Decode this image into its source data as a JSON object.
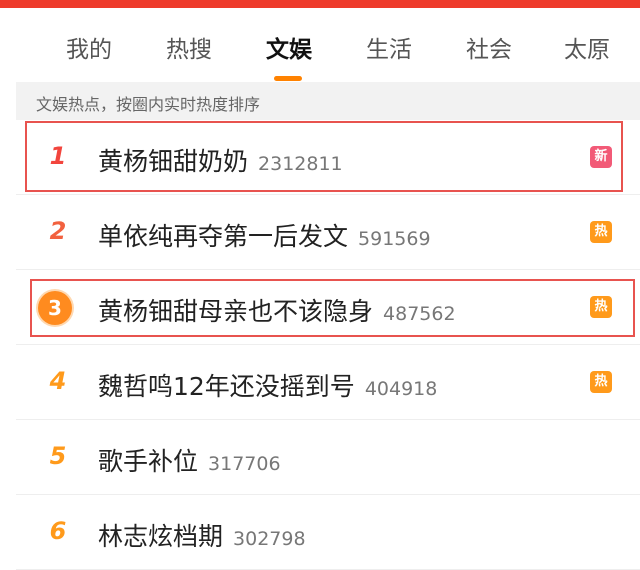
{
  "tabs": [
    {
      "label": "我的",
      "active": false
    },
    {
      "label": "热搜",
      "active": false
    },
    {
      "label": "文娱",
      "active": true
    },
    {
      "label": "生活",
      "active": false
    },
    {
      "label": "社会",
      "active": false
    },
    {
      "label": "太原",
      "active": false
    }
  ],
  "info_text": "文娱热点，按圈内实时热度排序",
  "items": [
    {
      "rank": "1",
      "title": "黄杨钿甜奶奶",
      "count": "2312811",
      "tag": "新"
    },
    {
      "rank": "2",
      "title": "单依纯再夺第一后发文",
      "count": "591569",
      "tag": "热"
    },
    {
      "rank": "3",
      "title": "黄杨钿甜母亲也不该隐身",
      "count": "487562",
      "tag": "热"
    },
    {
      "rank": "4",
      "title": "魏哲鸣12年还没摇到号",
      "count": "404918",
      "tag": "热"
    },
    {
      "rank": "5",
      "title": "歌手补位",
      "count": "317706",
      "tag": ""
    },
    {
      "rank": "6",
      "title": "林志炫档期",
      "count": "302798",
      "tag": ""
    }
  ],
  "colors": {
    "brand_red": "#ee3b2b",
    "rank_1": "#f2453d",
    "rank_2": "#f2613f",
    "rank_3": "#ff8b1f",
    "rank_other": "#ff9a1b",
    "tag_new": "#f25a77",
    "tag_hot": "#ff9a1b",
    "tab_underline": "#ff8200",
    "highlight_border": "#e8534f"
  },
  "icons": {
    "tag_new": "new-badge-icon",
    "tag_hot": "hot-badge-icon",
    "rank_badge": "rank-3-medal-icon"
  }
}
